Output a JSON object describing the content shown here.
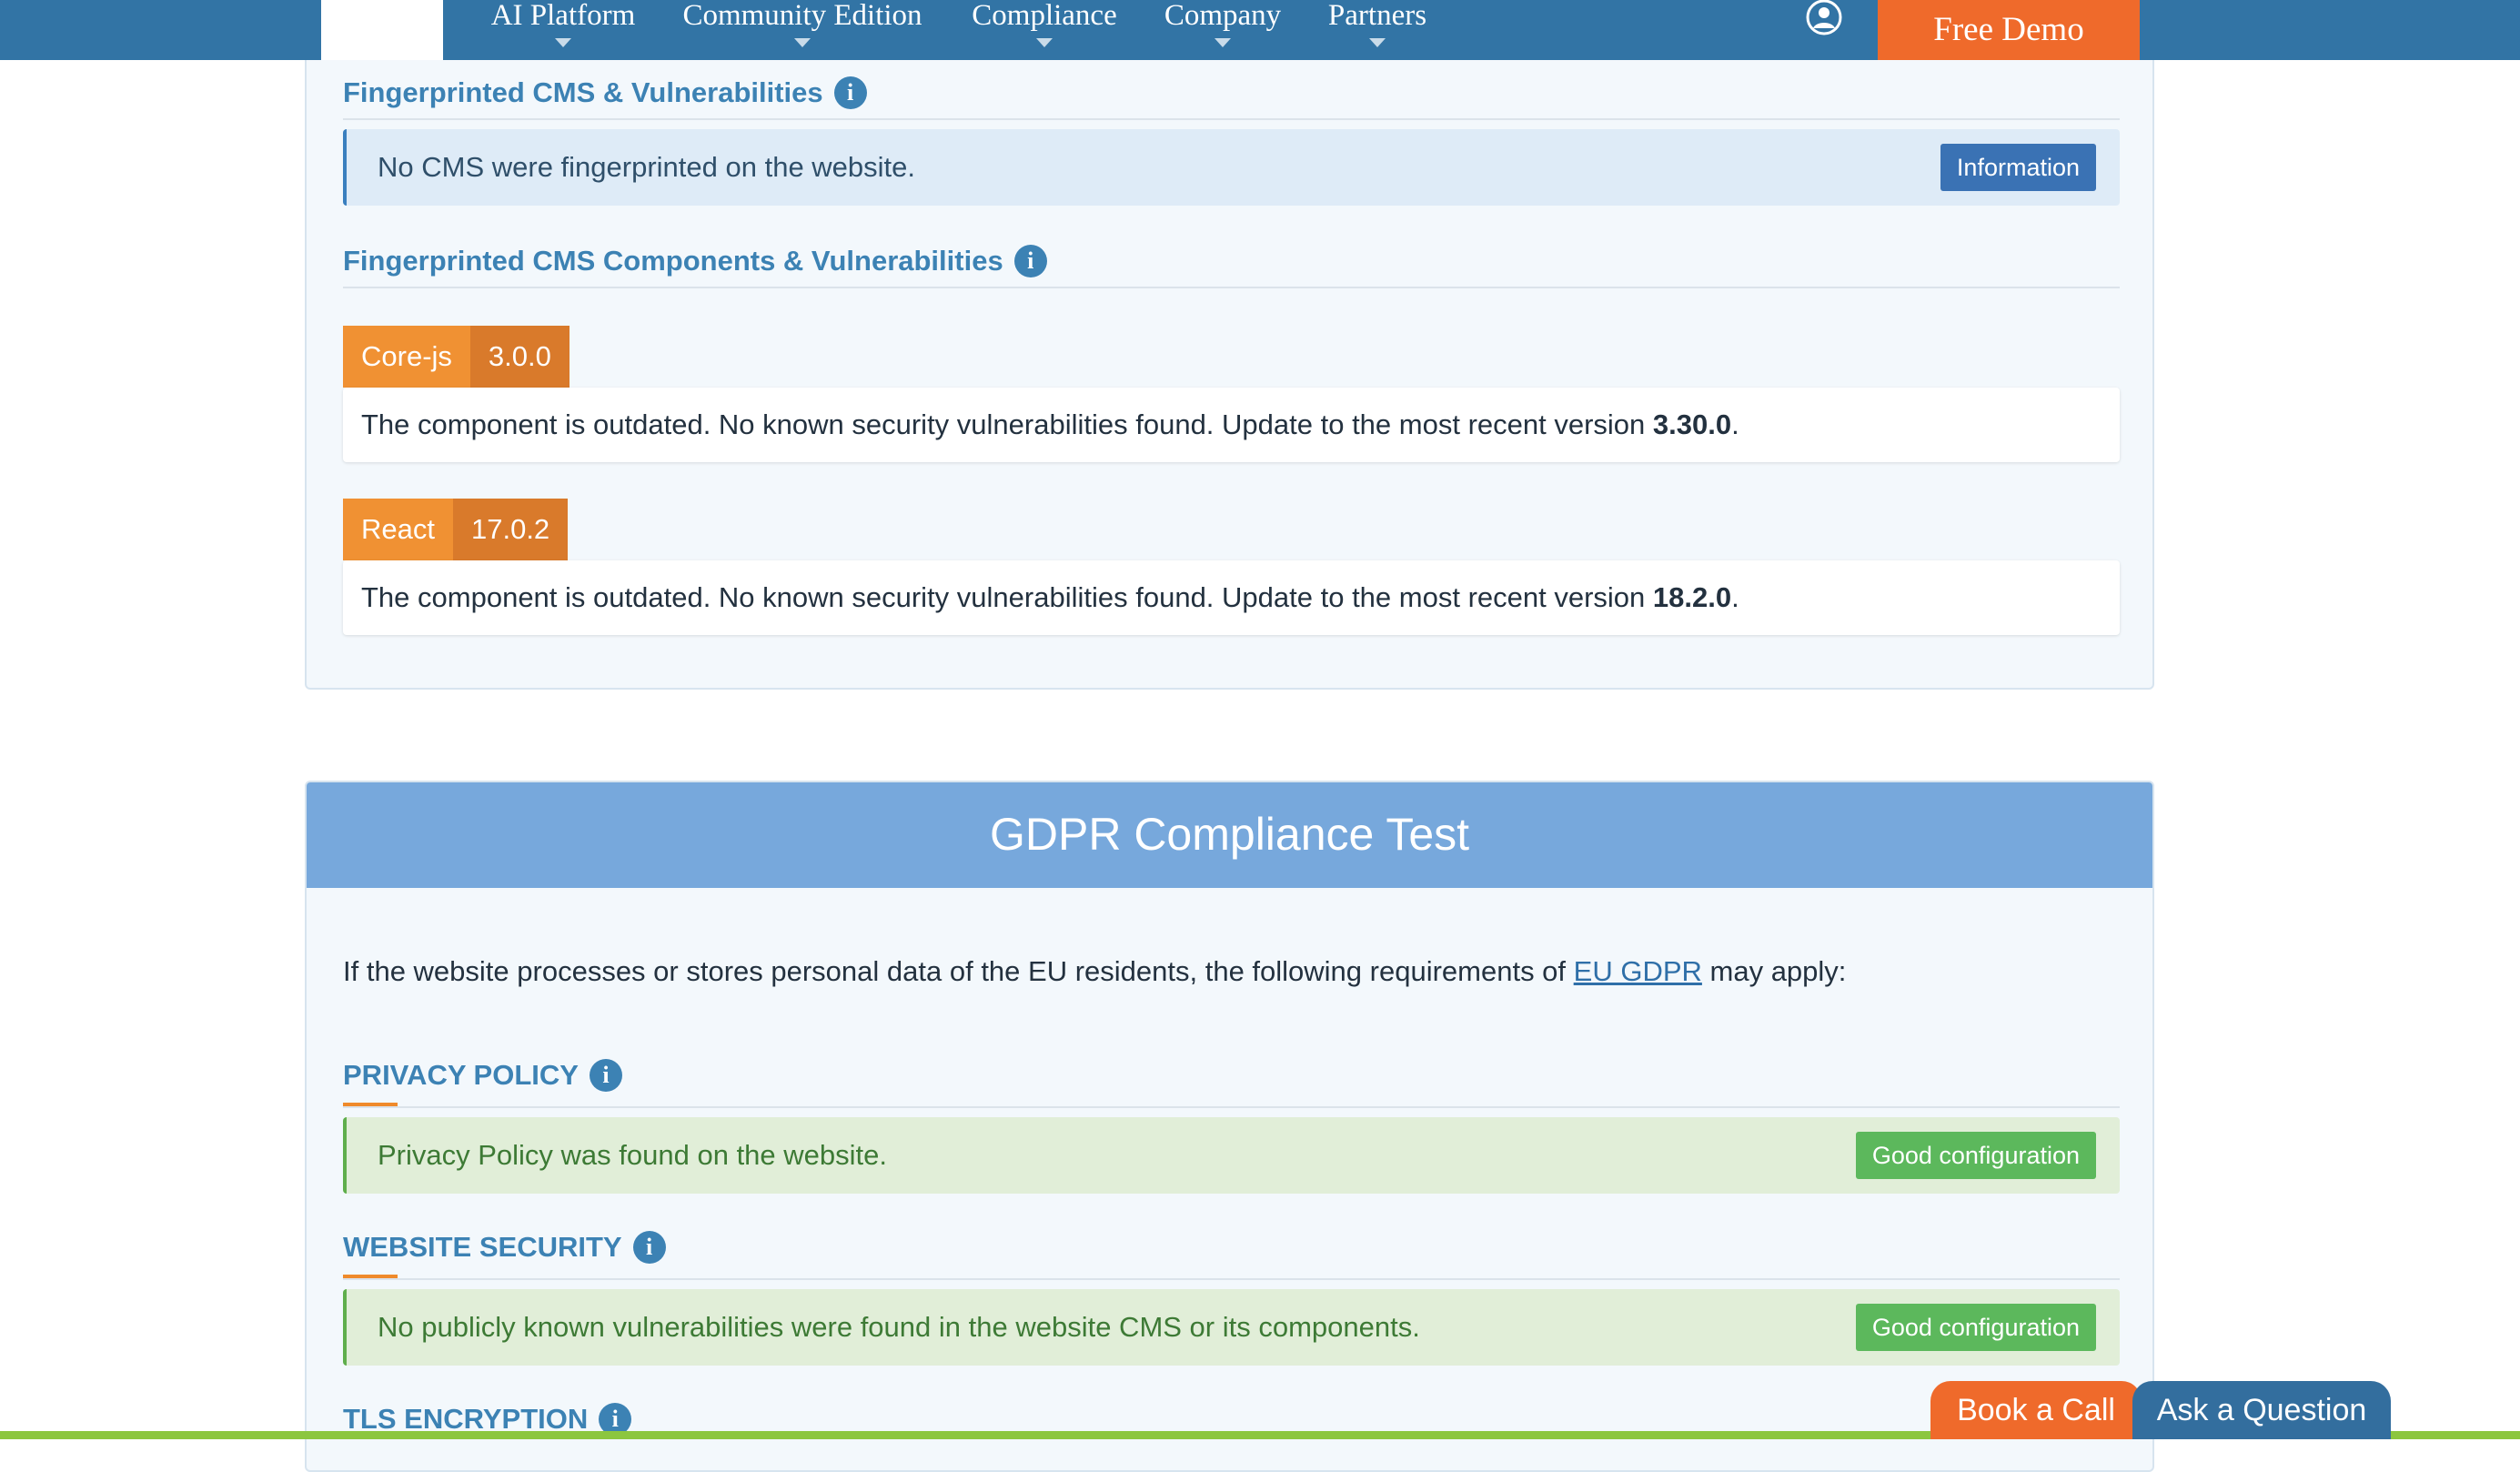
{
  "nav": {
    "items": [
      {
        "label": "AI Platform"
      },
      {
        "label": "Community Edition"
      },
      {
        "label": "Compliance"
      },
      {
        "label": "Company"
      },
      {
        "label": "Partners"
      }
    ],
    "cta_label": "Free Demo",
    "user_icon": "user-circle-icon"
  },
  "cms": {
    "title": "Fingerprinted CMS & Vulnerabilities",
    "message": "No CMS were fingerprinted on the website.",
    "badge": "Information"
  },
  "components": {
    "title": "Fingerprinted CMS Components & Vulnerabilities",
    "items": [
      {
        "name": "Core-js",
        "version": "3.0.0",
        "text": "The component is outdated. No known security vulnerabilities found. Update to the most recent version ",
        "latest": "3.30.0",
        "suffix": "."
      },
      {
        "name": "React",
        "version": "17.0.2",
        "text": "The component is outdated. No known security vulnerabilities found. Update to the most recent version ",
        "latest": "18.2.0",
        "suffix": "."
      }
    ]
  },
  "gdpr": {
    "title": "GDPR Compliance Test",
    "intro_before": "If the website processes or stores personal data of the EU residents, the following requirements of ",
    "intro_link": "EU GDPR",
    "intro_after": " may apply:",
    "sections": [
      {
        "title": "PRIVACY POLICY",
        "message": "Privacy Policy was found on the website.",
        "badge": "Good configuration"
      },
      {
        "title": "WEBSITE SECURITY",
        "message": "No publicly known vulnerabilities were found in the website CMS or its components.",
        "badge": "Good configuration"
      },
      {
        "title": "TLS ENCRYPTION"
      }
    ]
  },
  "floating": {
    "book_call": "Book a Call",
    "ask_question": "Ask a Question"
  },
  "colors": {
    "nav_bg": "#3274a5",
    "accent_orange": "#ef6a2b",
    "section_title": "#3c82b4",
    "gdpr_header": "#77a8dc",
    "good_badge": "#5cb85c"
  }
}
